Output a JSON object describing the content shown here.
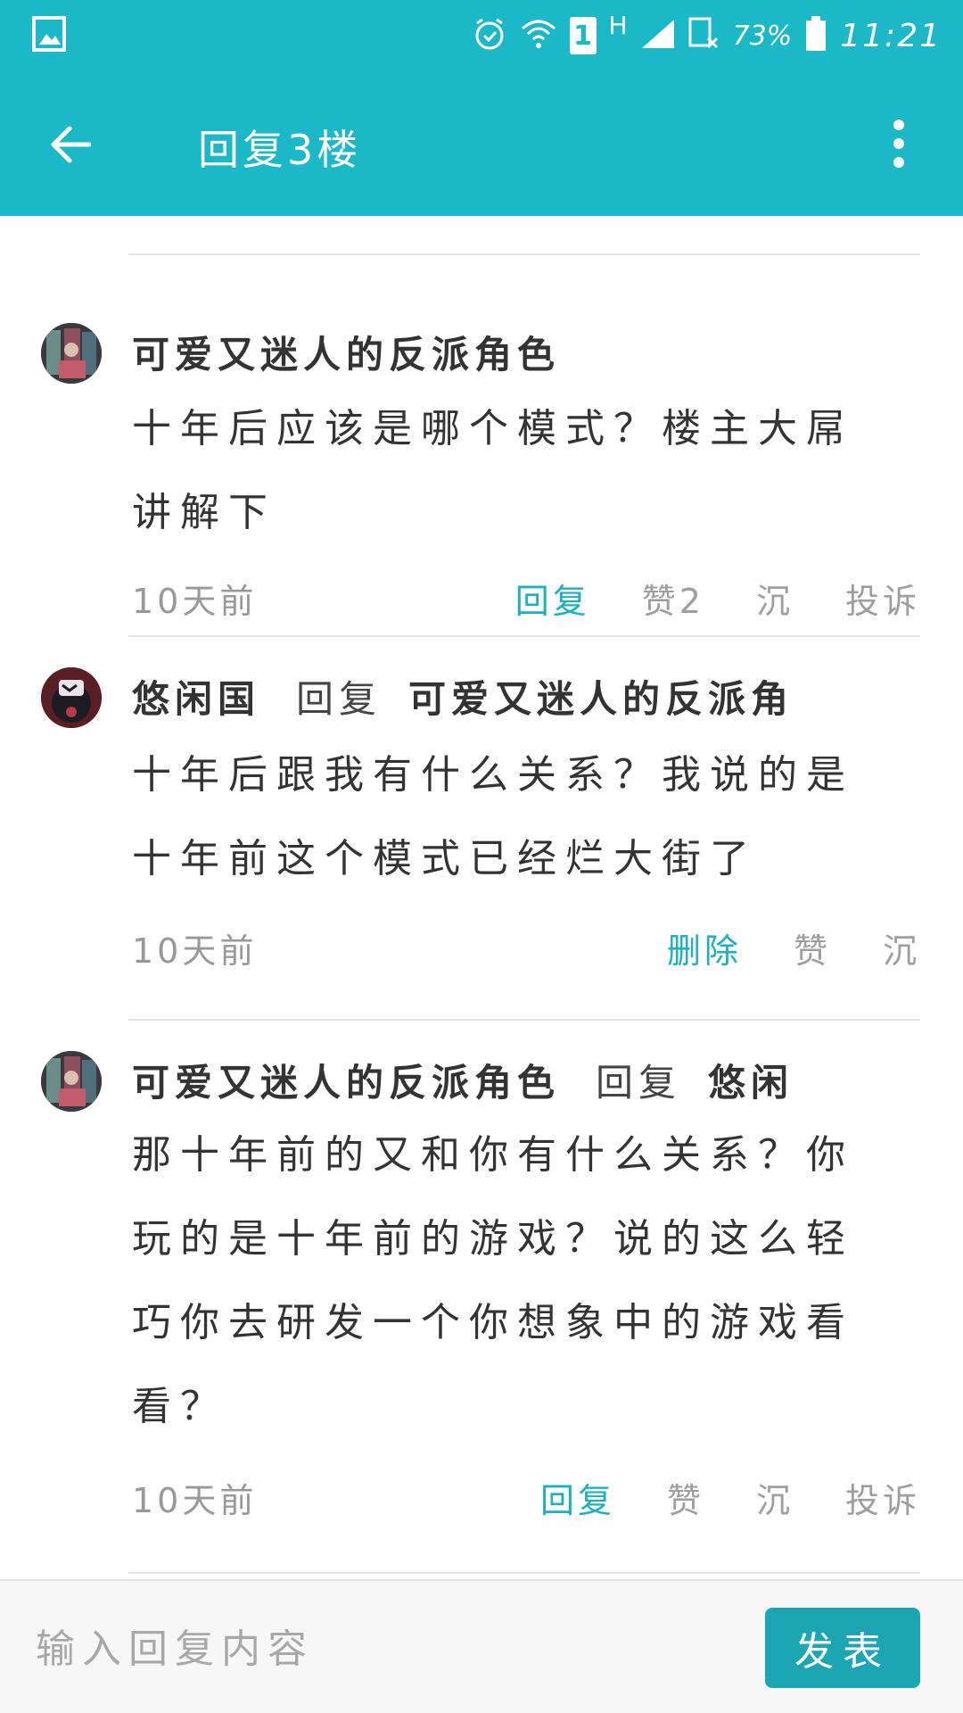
{
  "status_bar": {
    "sim_slot": "1",
    "network": "H",
    "battery": "73%",
    "time": "11:21"
  },
  "app_bar": {
    "title": "回复3楼"
  },
  "comments": [
    {
      "author": "可爱又迷人的反派角色",
      "reply_word": "",
      "reply_to": "",
      "text": "十年后应该是哪个模式？楼主大屌讲解下",
      "time": "10天前",
      "actions": [
        "回复",
        "赞2",
        "沉",
        "投诉"
      ]
    },
    {
      "author": "悠闲国",
      "reply_word": "回复",
      "reply_to": "可爱又迷人的反派角",
      "text": "十年后跟我有什么关系？我说的是十年前这个模式已经烂大街了",
      "time": "10天前",
      "actions": [
        "删除",
        "赞",
        "沉"
      ]
    },
    {
      "author": "可爱又迷人的反派角色",
      "reply_word": "回复",
      "reply_to": "悠闲",
      "text": "那十年前的又和你有什么关系？你玩的是十年前的游戏？说的这么轻巧你去研发一个你想象中的游戏看看？",
      "time": "10天前",
      "actions": [
        "回复",
        "赞",
        "沉",
        "投诉"
      ]
    }
  ],
  "input_bar": {
    "placeholder": "输入回复内容",
    "submit_label": "发表"
  },
  "colors": {
    "primary": "#1bb8c8",
    "accent_text": "#1bb1c1",
    "button": "#1ca6b4"
  }
}
